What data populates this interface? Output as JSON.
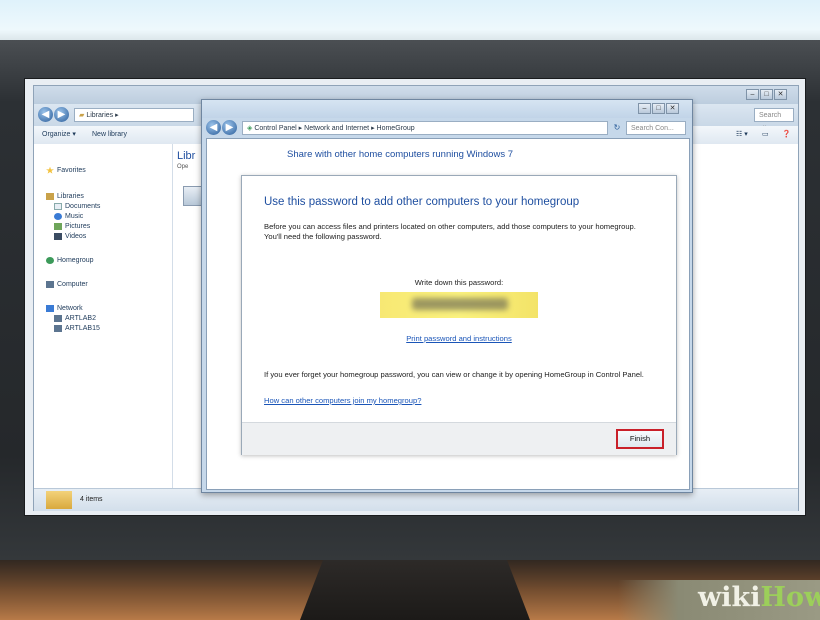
{
  "explorer": {
    "breadcrumb": "Libraries",
    "toolbar": {
      "organize": "Organize ▾",
      "new_library": "New library"
    },
    "search_placeholder": "Search Libr...",
    "sidebar": {
      "favorites": "Favorites",
      "libraries": "Libraries",
      "library_items": [
        "Documents",
        "Music",
        "Pictures",
        "Videos"
      ],
      "homegroup": "Homegroup",
      "computer": "Computer",
      "network": "Network",
      "network_items": [
        "ARTLAB2",
        "ARTLAB15"
      ]
    },
    "main_title": "Libr",
    "main_sub": "Ope",
    "status": "4 items"
  },
  "dialog": {
    "breadcrumb": "Control Panel ▸ Network and Internet ▸ HomeGroup",
    "search_placeholder": "Search Con...",
    "heading": "Share with other home computers running Windows 7",
    "inner_title": "Use this password to add other computers to your homegroup",
    "intro": "Before you can access files and printers located on other computers, add those computers to your homegroup. You'll need the following password.",
    "write_label": "Write down this password:",
    "print_link": "Print password and instructions",
    "forget_text": "If you ever forget your homegroup password, you can view or change it by opening HomeGroup in Control Panel.",
    "how_link": "How can other computers join my homegroup?",
    "finish_label": "Finish"
  },
  "watermark": {
    "wiki": "wiki",
    "how": "How"
  },
  "colors": {
    "accent": "#1f4fa0",
    "link": "#1a55b8",
    "highlight": "#c9202a",
    "password_bg": "#fbf27e"
  }
}
